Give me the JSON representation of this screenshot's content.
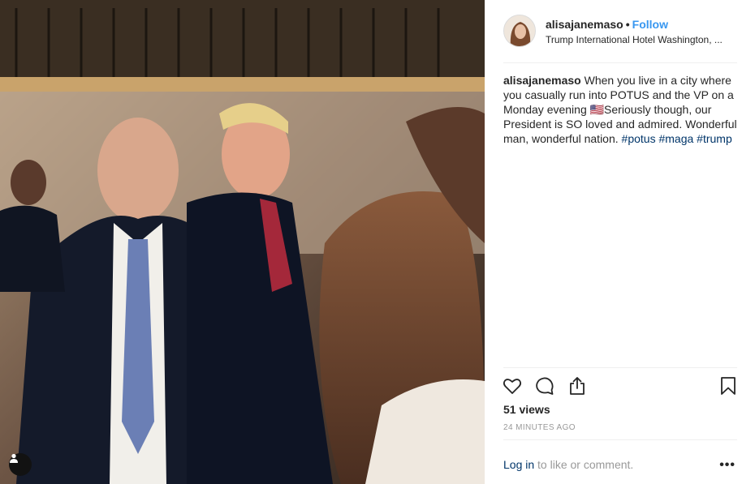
{
  "post": {
    "username": "alisajanemaso",
    "separator": "•",
    "follow_label": "Follow",
    "location": "Trump International Hotel Washington, ...",
    "caption_user": "alisajanemaso",
    "caption_text": " When you live in a city where you casually run into POTUS and the VP on a Monday evening 🇺🇸Seriously though, our President is SO loved and admired. Wonderful man, wonderful nation. ",
    "hashtags": [
      "#potus",
      "#maga",
      "#trump"
    ],
    "views": "51 views",
    "timestamp": "24 MINUTES AGO",
    "login_label": "Log in",
    "login_suffix": " to like or comment.",
    "more_label": "•••"
  },
  "icons": {
    "like": "heart-icon",
    "comment": "comment-icon",
    "share": "share-icon",
    "save": "bookmark-icon",
    "user_tag": "user-icon"
  },
  "colors": {
    "link_blue": "#3897f0",
    "hashtag_blue": "#003569",
    "muted_gray": "#999999",
    "divider": "#efefef"
  }
}
